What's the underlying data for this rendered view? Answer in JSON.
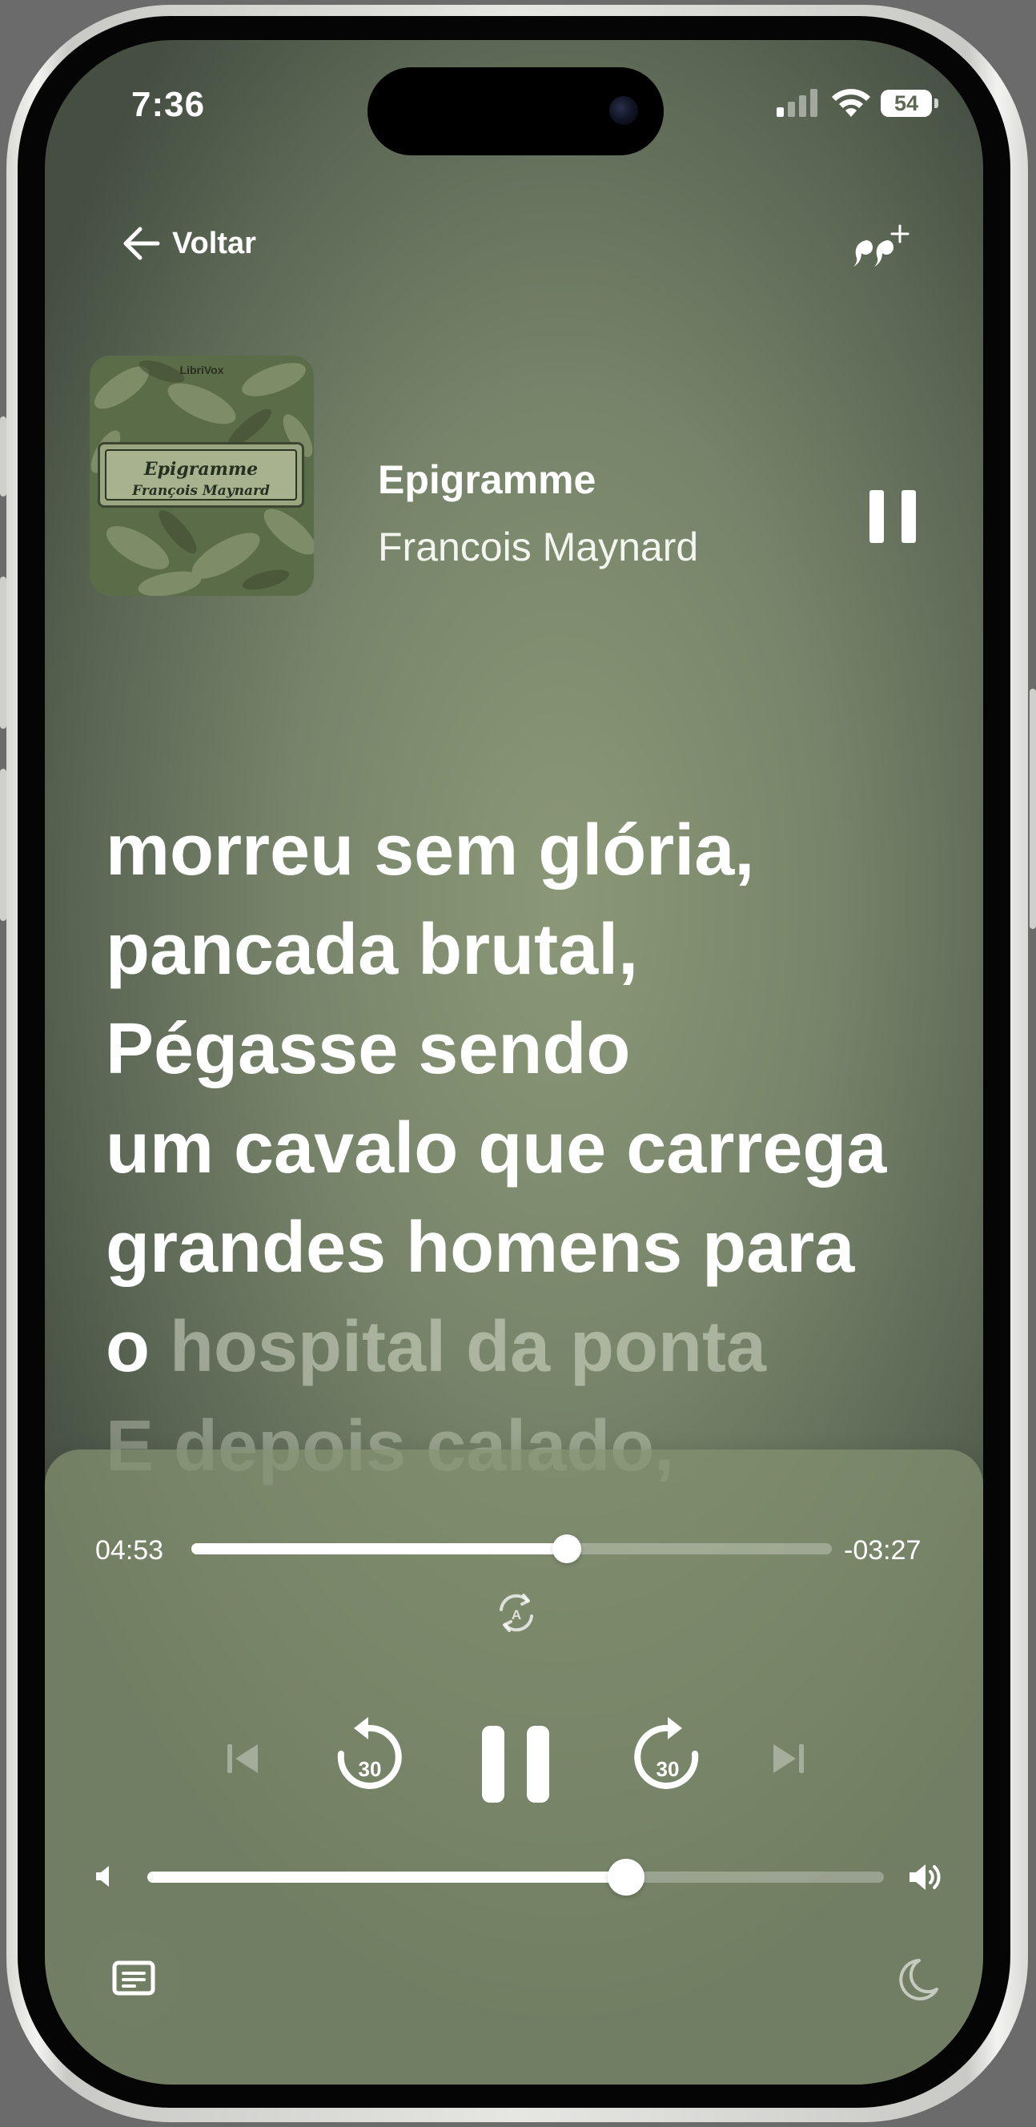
{
  "status_bar": {
    "time": "7:36",
    "battery": "54"
  },
  "nav": {
    "back_label": "Voltar",
    "quote_icon": "add-quote-icon"
  },
  "now_playing": {
    "cover": {
      "publisher": "LibriVox",
      "title": "Epigramme",
      "author": "François Maynard"
    },
    "title": "Epigramme",
    "author": "Francois Maynard"
  },
  "lyrics": {
    "lines": [
      {
        "text": "morreu sem glória,",
        "state": "read"
      },
      {
        "text": "pancada brutal,",
        "state": "read"
      },
      {
        "text": "Pégasse sendo",
        "state": "read"
      },
      {
        "text": "um cavalo que carrega",
        "state": "read"
      },
      {
        "text": "grandes homens para",
        "state": "read"
      }
    ],
    "current_line": {
      "spoken": "o ",
      "upcoming": "hospital da ponta"
    },
    "next_line": "E depois calado,"
  },
  "player": {
    "elapsed": "04:53",
    "remaining": "-03:27",
    "progress_fraction": 0.586,
    "skip_back_seconds": "30",
    "skip_forward_seconds": "30",
    "volume_fraction": 0.65,
    "colors": {
      "accent": "#ffffff",
      "background": "#7a876b"
    }
  }
}
